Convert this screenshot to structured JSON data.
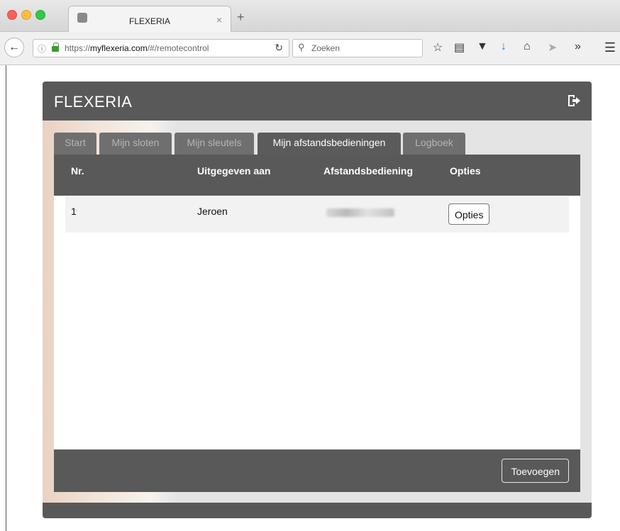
{
  "browser": {
    "tab_title": "FLEXERIA",
    "tab_close": "×",
    "new_tab": "+",
    "url_prefix": "https://",
    "url_domain": "myflexeria.com",
    "url_path": "/#/remotecontrol",
    "search_placeholder": "Zoeken",
    "toolbar_icons": [
      "star-icon",
      "reader-icon",
      "pocket-icon",
      "download-icon",
      "home-icon",
      "send-icon",
      "overflow-icon"
    ]
  },
  "app": {
    "brand": "FLEXERIA",
    "tabs": [
      {
        "label": "Start",
        "active": false
      },
      {
        "label": "Mijn sloten",
        "active": false
      },
      {
        "label": "Mijn sleutels",
        "active": false
      },
      {
        "label": "Mijn afstandsbedieningen",
        "active": true
      },
      {
        "label": "Logboek",
        "active": false
      }
    ],
    "table": {
      "headers": [
        "Nr.",
        "Uitgegeven aan",
        "Afstandsbediening",
        "Opties"
      ],
      "rows": [
        {
          "nr": "1",
          "issued_to": "Jeroen",
          "remote": "",
          "options_button": "Opties"
        }
      ]
    },
    "add_button": "Toevoegen"
  },
  "colors": {
    "header": "#595959",
    "tab_inactive": "#6f6f6f",
    "tab_active": "#5b5b5b",
    "row_bg": "#f2f2f2"
  }
}
